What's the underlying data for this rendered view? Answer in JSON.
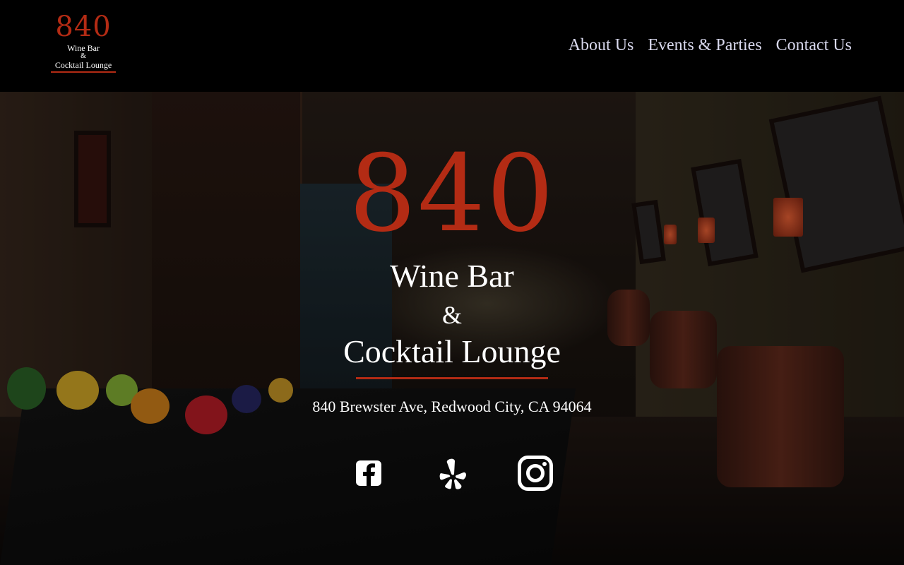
{
  "logo": {
    "number": "840",
    "line1": "Wine Bar",
    "line2": "&",
    "line3": "Cocktail Lounge"
  },
  "nav": {
    "items": [
      {
        "label": "About Us"
      },
      {
        "label": "Events & Parties"
      },
      {
        "label": "Contact Us"
      }
    ]
  },
  "hero": {
    "number": "840",
    "line1": "Wine Bar",
    "line2": "&",
    "line3": "Cocktail Lounge",
    "address": "840 Brewster Ave, Redwood City, CA 94064"
  },
  "social": {
    "icons": [
      "facebook-icon",
      "yelp-icon",
      "instagram-icon"
    ]
  },
  "colors": {
    "accent": "#b32b14",
    "nav_text": "#d9d9ee",
    "background": "#000000"
  }
}
